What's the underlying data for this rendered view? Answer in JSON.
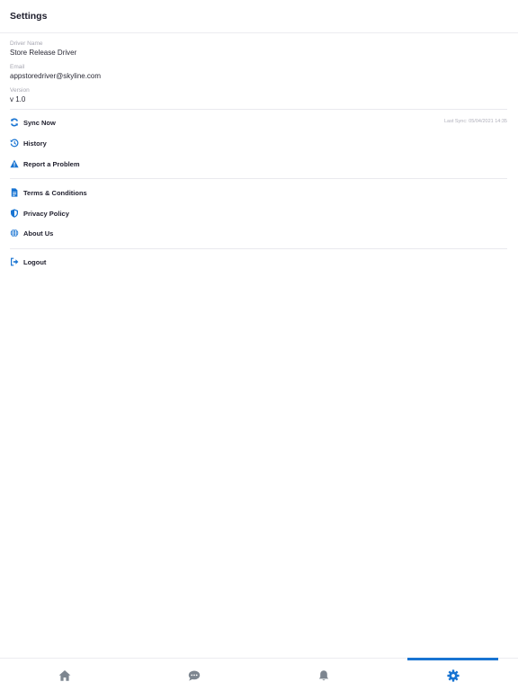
{
  "header": {
    "title": "Settings"
  },
  "profile": {
    "driver_name_label": "Driver Name",
    "driver_name_value": "Store Release Driver",
    "email_label": "Email",
    "email_value": "appstoredriver@skyline.com",
    "version_label": "Version",
    "version_value": "v 1.0"
  },
  "menu": {
    "sync_label": "Sync Now",
    "sync_meta": "Last Sync: 05/04/2021 14:35",
    "history_label": "History",
    "report_label": "Report a Problem",
    "terms_label": "Terms & Conditions",
    "privacy_label": "Privacy Policy",
    "about_label": "About Us",
    "logout_label": "Logout"
  },
  "icons": {
    "sync": "sync-icon",
    "history": "history-icon",
    "report": "warning-icon",
    "terms": "document-icon",
    "privacy": "shield-icon",
    "about": "globe-icon",
    "logout": "logout-icon",
    "tab_home": "home-icon",
    "tab_messages": "chat-icon",
    "tab_notifications": "bell-icon",
    "tab_settings": "gear-icon"
  },
  "tabs": {
    "active": "settings"
  },
  "colors": {
    "accent": "#1874d2",
    "icon_inactive": "#7d8690",
    "text_primary": "#1d1d2b",
    "text_muted": "#a7a7b2"
  }
}
